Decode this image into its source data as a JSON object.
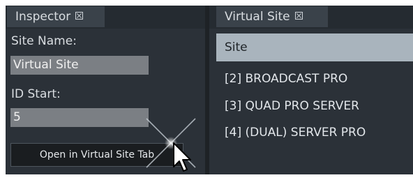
{
  "inspector": {
    "tab_label": "Inspector",
    "site_name_label": "Site Name:",
    "site_name_value": "Virtual Site",
    "id_start_label": "ID Start:",
    "id_start_value": "5",
    "open_button_label": "Open in Virtual Site Tab"
  },
  "virtual_site": {
    "tab_label": "Virtual Site",
    "column_header": "Site",
    "items": [
      "[2] BROADCAST PRO",
      "[3] QUAD PRO SERVER",
      "[4] (DUAL) SERVER PRO"
    ]
  },
  "colors": {
    "panel_bg": "#2b3138",
    "tab_bg": "#3a424a",
    "header_bg": "#a9b4bd",
    "field_bg": "#7b7f84"
  }
}
